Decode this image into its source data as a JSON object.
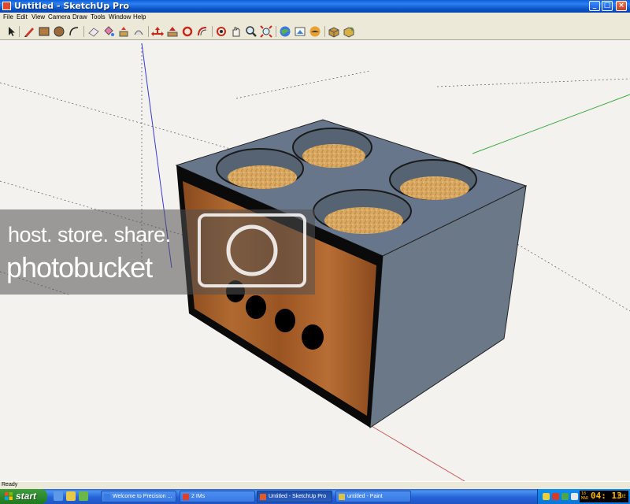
{
  "window": {
    "title": "Untitled - SketchUp Pro",
    "controls": {
      "minimize": "_",
      "maximize": "□",
      "close": "×"
    }
  },
  "menu": [
    "File",
    "Edit",
    "View",
    "Camera",
    "Draw",
    "Tools",
    "Window",
    "Help"
  ],
  "toolbar": {
    "tools": [
      "select-tool",
      "pencil-tool",
      "rectangle-tool",
      "circle-tool",
      "arc-tool",
      "eraser-tool",
      "paint-bucket-tool",
      "push-pull-tool",
      "follow-me-tool",
      "move-tool",
      "rotate-tool",
      "scale-tool",
      "offset-tool",
      "orbit-tool",
      "pan-tool",
      "zoom-tool",
      "zoom-extents-tool",
      "get-models-tool",
      "share-model-tool",
      "google-earth-tool",
      "components-tool",
      "materials-tool"
    ]
  },
  "watermark": {
    "line1": "host. store. share.",
    "line2": "photobucket"
  },
  "status": {
    "text": "Ready"
  },
  "taskbar": {
    "start_label": "start",
    "tasks": [
      {
        "label": "Welcome to Precision ...",
        "icon_color": "#3a7be0",
        "active": false
      },
      {
        "label": "2 IMs",
        "icon_color": "#e0402a",
        "active": false
      },
      {
        "label": "Untitled - SketchUp Pro",
        "icon_color": "#e05a2a",
        "active": true
      },
      {
        "label": "untitled - Paint",
        "icon_color": "#d8c24a",
        "active": false
      }
    ],
    "clock": {
      "date_top": "18",
      "date_bottom": "MAR",
      "time": "04: 13",
      "day": "TUE"
    }
  },
  "colors": {
    "box_gray": "#6c7b88",
    "box_top": "#67768a",
    "front_panel": "#a05a26",
    "port_black": "#000000",
    "sand": "#d9a860",
    "axis_red": "#c85a5a",
    "axis_green": "#3aa83a",
    "axis_blue": "#3a3ad8"
  }
}
